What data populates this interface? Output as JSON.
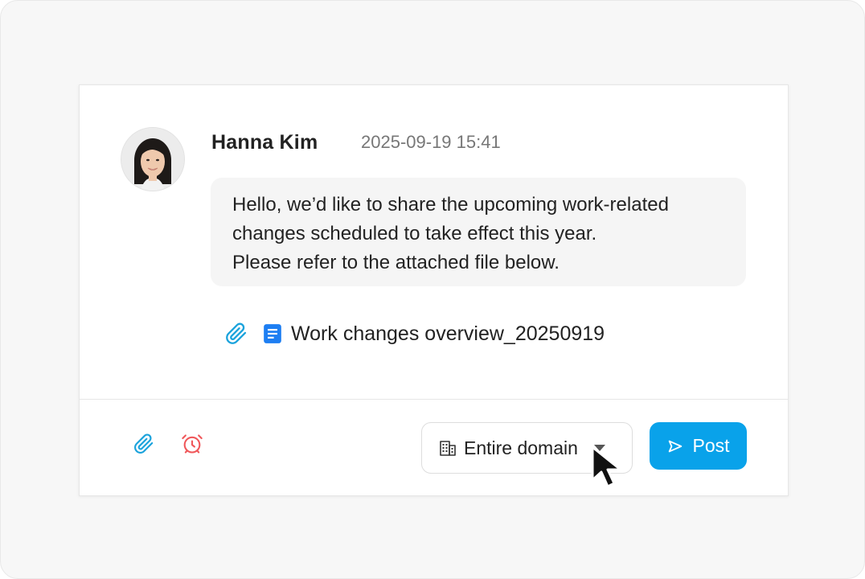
{
  "post": {
    "author": "Hanna Kim",
    "timestamp": "2025-09-19 15:41",
    "message_lines": [
      "Hello, we’d like to share the upcoming work-related",
      "changes scheduled to take effect this year.",
      "Please refer to the attached file below."
    ],
    "attachment": {
      "file_name": "Work changes overview_20250919",
      "icons": [
        "paperclip-icon",
        "document-icon"
      ]
    }
  },
  "composer": {
    "tools": [
      {
        "icon": "paperclip-icon"
      },
      {
        "icon": "alarm-clock-icon"
      }
    ],
    "scope": {
      "icon": "building-icon",
      "selected": "Entire domain"
    },
    "post_button": {
      "icon": "send-icon",
      "label": "Post"
    }
  },
  "colors": {
    "accent": "#09a2ea",
    "attach_icon": "#1ba3dc",
    "alarm_icon": "#f0575a",
    "doc_icon": "#1d7ef2"
  }
}
